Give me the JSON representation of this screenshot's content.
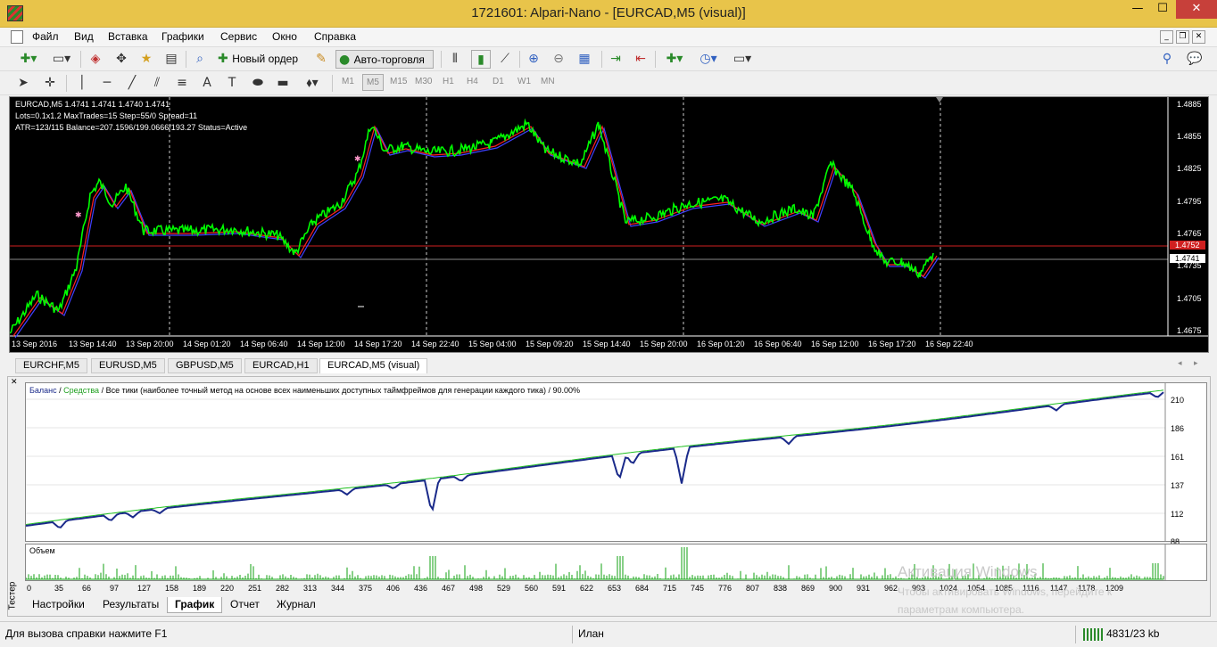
{
  "window": {
    "title": "1721601: Alpari-Nano - [EURCAD,M5 (visual)]",
    "min": "—",
    "max": "☐",
    "close": "✕"
  },
  "menu": [
    "Файл",
    "Вид",
    "Вставка",
    "Графики",
    "Сервис",
    "Окно",
    "Справка"
  ],
  "toolbar": {
    "new_order": "Новый ордер",
    "autotrade": "Авто-торговля"
  },
  "timeframes": [
    "M1",
    "M5",
    "M15",
    "M30",
    "H1",
    "H4",
    "D1",
    "W1",
    "MN"
  ],
  "chart": {
    "info_lines": [
      "EURCAD,M5  1.4741 1.4741 1.4740 1.4741",
      "Lots=0.1x1.2 MaxTrades=15 Step=55/0 Spread=11",
      "ATR=123/115 Balance=207.1596/199.0666/193.27 Status=Active"
    ],
    "price_labels": [
      "1.4885",
      "1.4855",
      "1.4825",
      "1.4795",
      "1.4765",
      "1.4735",
      "1.4705",
      "1.4675"
    ],
    "red_level": "1.4752",
    "current_price": "1.4741",
    "time_labels": [
      "13 Sep 2016",
      "13 Sep 14:40",
      "13 Sep 20:00",
      "14 Sep 01:20",
      "14 Sep 06:40",
      "14 Sep 12:00",
      "14 Sep 17:20",
      "14 Sep 22:40",
      "15 Sep 04:00",
      "15 Sep 09:20",
      "15 Sep 14:40",
      "15 Sep 20:00",
      "16 Sep 01:20",
      "16 Sep 06:40",
      "16 Sep 12:00",
      "16 Sep 17:20",
      "16 Sep 22:40"
    ],
    "colors": {
      "price": "#00ff00",
      "ma": "#ff2020",
      "ma2": "#4040ff"
    }
  },
  "chart_tabs": [
    "EURCHF,M5",
    "EURUSD,M5",
    "GBPUSD,M5",
    "EURCAD,H1",
    "EURCAD,M5 (visual)"
  ],
  "tester": {
    "side_label": "Тестер",
    "legend_balance": "Баланс",
    "legend_equity": "Средства",
    "legend_rest": "/ Все тики (наиболее точный метод на основе всех наименьших доступных таймфреймов для генерации каждого тика) / 90.00%",
    "volume_label": "Объем",
    "y_labels": [
      "210",
      "186",
      "161",
      "137",
      "112",
      "88"
    ],
    "x_labels": [
      "0",
      "35",
      "66",
      "97",
      "127",
      "158",
      "189",
      "220",
      "251",
      "282",
      "313",
      "344",
      "375",
      "406",
      "436",
      "467",
      "498",
      "529",
      "560",
      "591",
      "622",
      "653",
      "684",
      "715",
      "745",
      "776",
      "807",
      "838",
      "869",
      "900",
      "931",
      "962",
      "993",
      "1024",
      "1054",
      "1085",
      "1116",
      "1147",
      "1178",
      "1209"
    ],
    "tabs": [
      "Настройки",
      "Результаты",
      "График",
      "Отчет",
      "Журнал"
    ],
    "active_tab": "График"
  },
  "watermark": {
    "line1": "Активация Windows",
    "line2": "Чтобы активировать Windows, перейдите к",
    "line3": "параметрам компьютера."
  },
  "status": {
    "help": "Для вызова справки нажмите F1",
    "profile": "Илан",
    "traffic": "4831/23 kb"
  }
}
